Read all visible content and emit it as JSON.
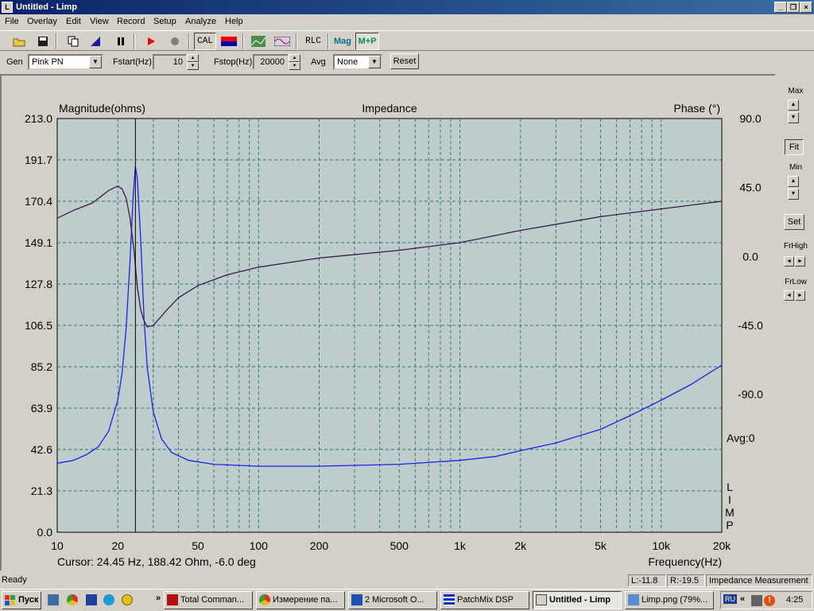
{
  "window": {
    "title": "Untitled - Limp",
    "icon": "app-icon"
  },
  "menu": [
    "File",
    "Overlay",
    "Edit",
    "View",
    "Record",
    "Setup",
    "Analyze",
    "Help"
  ],
  "toolbar": {
    "cal_label": "CAL",
    "rlc_label": "RLC",
    "mag_label": "Mag",
    "mp_label": "M+P"
  },
  "params": {
    "gen_label": "Gen",
    "gen_value": "Pink PN",
    "fstart_label": "Fstart(Hz)",
    "fstart_value": "10",
    "fstop_label": "Fstop(Hz)",
    "fstop_value": "20000",
    "avg_label": "Avg",
    "avg_value": "None",
    "reset_label": "Reset"
  },
  "side": {
    "max_label": "Max",
    "fit_label": "Fit",
    "min_label": "Min",
    "set_label": "Set",
    "frhigh_label": "FrHigh",
    "frlow_label": "FrLow"
  },
  "chart_data": {
    "type": "line",
    "title": "Impedance",
    "ylabel": "Magnitude(ohms)",
    "y2label": "Phase (°)",
    "xlabel": "Frequency(Hz)",
    "avg_label": "Avg:0",
    "watermark": [
      "L",
      "I",
      "M",
      "P"
    ],
    "x_scale": "log",
    "xlim": [
      10,
      20000
    ],
    "ylim": [
      0.0,
      213.0
    ],
    "y2lim": [
      -180,
      90
    ],
    "y_ticks": [
      "213.0",
      "191.7",
      "170.4",
      "149.1",
      "127.8",
      "106.5",
      "85.2",
      "63.9",
      "42.6",
      "21.3",
      "0.0"
    ],
    "y2_ticks": [
      "90.0",
      "45.0",
      "0.0",
      "-45.0",
      "-90.0"
    ],
    "y2_tick_values": [
      90,
      45,
      0,
      -45,
      -90
    ],
    "x_ticks": [
      {
        "v": 10,
        "label": "10"
      },
      {
        "v": 20,
        "label": "20"
      },
      {
        "v": 50,
        "label": "50"
      },
      {
        "v": 100,
        "label": "100"
      },
      {
        "v": 200,
        "label": "200"
      },
      {
        "v": 500,
        "label": "500"
      },
      {
        "v": 1000,
        "label": "1k"
      },
      {
        "v": 2000,
        "label": "2k"
      },
      {
        "v": 5000,
        "label": "5k"
      },
      {
        "v": 10000,
        "label": "10k"
      },
      {
        "v": 20000,
        "label": "20k"
      }
    ],
    "cursor_x": 24.45,
    "cursor_text": "Cursor: 24.45 Hz, 188.42 Ohm, -6.0 deg",
    "series": [
      {
        "name": "Magnitude",
        "color": "#1e22e6",
        "axis": "left",
        "points": [
          [
            10,
            35.5
          ],
          [
            12,
            37
          ],
          [
            14,
            40
          ],
          [
            16,
            44
          ],
          [
            18,
            52
          ],
          [
            20,
            68
          ],
          [
            21,
            82
          ],
          [
            22,
            105
          ],
          [
            23,
            140
          ],
          [
            23.8,
            172
          ],
          [
            24.45,
            188.4
          ],
          [
            25,
            182
          ],
          [
            26,
            150
          ],
          [
            27,
            110
          ],
          [
            28,
            85
          ],
          [
            30,
            62
          ],
          [
            33,
            48
          ],
          [
            37,
            41
          ],
          [
            45,
            37
          ],
          [
            60,
            35
          ],
          [
            100,
            34
          ],
          [
            200,
            34
          ],
          [
            500,
            35
          ],
          [
            1000,
            37
          ],
          [
            1500,
            39
          ],
          [
            2000,
            42
          ],
          [
            3000,
            46
          ],
          [
            5000,
            53
          ],
          [
            7000,
            60
          ],
          [
            10000,
            68
          ],
          [
            14000,
            76
          ],
          [
            20000,
            86
          ]
        ]
      },
      {
        "name": "Phase",
        "color": "#3a1a4a",
        "axis": "right",
        "points": [
          [
            10,
            25
          ],
          [
            12,
            30
          ],
          [
            15,
            35
          ],
          [
            18,
            43
          ],
          [
            20,
            46
          ],
          [
            21,
            44
          ],
          [
            22,
            38
          ],
          [
            23,
            25
          ],
          [
            24,
            5
          ],
          [
            24.45,
            -6
          ],
          [
            25,
            -20
          ],
          [
            26,
            -35
          ],
          [
            27,
            -42
          ],
          [
            28,
            -46
          ],
          [
            30,
            -45
          ],
          [
            35,
            -35
          ],
          [
            40,
            -27
          ],
          [
            50,
            -19
          ],
          [
            70,
            -12
          ],
          [
            100,
            -7
          ],
          [
            200,
            -1
          ],
          [
            500,
            4
          ],
          [
            1000,
            9
          ],
          [
            2000,
            17
          ],
          [
            5000,
            26
          ],
          [
            10000,
            31
          ],
          [
            20000,
            36
          ]
        ]
      }
    ]
  },
  "status": {
    "ready": "Ready",
    "l": "L:-11.8",
    "r": "R:-19.5",
    "mode": "Impedance Measurement"
  },
  "taskbar": {
    "start": "Пуск",
    "tasks": [
      "Total Comman...",
      "Измерение па...",
      "2 Microsoft O...",
      "PatchMix DSP",
      "Untitled - Limp",
      "Limp.png (79%..."
    ],
    "lang": "RU",
    "clock": "4:25"
  }
}
